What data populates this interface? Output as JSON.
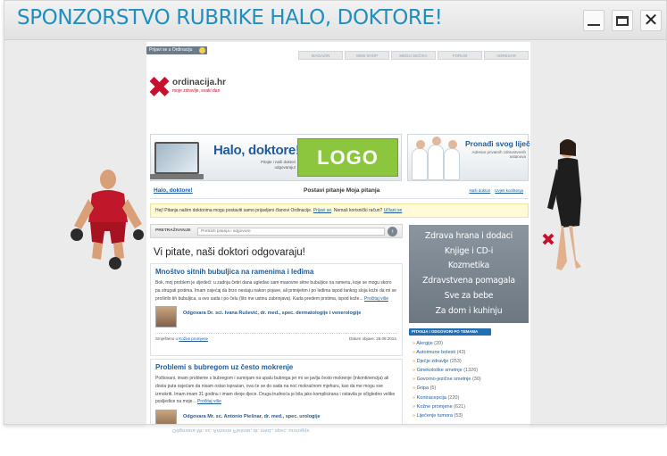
{
  "window": {
    "title": "SPONZORSTVO RUBRIKE HALO, DOKTORE!"
  },
  "site": {
    "login_label": "Prijavi se u Ordinaciju",
    "top_tabs": [
      "MAGAZIN",
      "WEB SHOP",
      "MEDIJ SEČIKA",
      "FORUM",
      "ADRESAR"
    ],
    "brand": {
      "name": "ordinacija.hr",
      "tagline": "moje zdravlje, svaki dan"
    },
    "banner_halo": {
      "title": "Halo, doktore!",
      "subtitle": "Pitajte i naši doktori odgovaraju!",
      "logo": "LOGO"
    },
    "banner_doc": {
      "title": "Pronađi svog liječnika!",
      "subtitle": "Adresar privatnih zdravstvenih ustanova"
    },
    "nav": {
      "home": "Halo, doktore!",
      "ask": "Postavi pitanje",
      "my": "Moja pitanja",
      "terms": "Naši doktori",
      "rules": "Uvjeti korištenja"
    },
    "notice": {
      "text": "Hej! Pitanja našim doktorima mogu postaviti samo prijavljeni članovi Ordinacije.",
      "login": "Prijavi se",
      "q": "Nemaš korisnički račun?",
      "register": "Učlani se"
    },
    "search": {
      "label": "PRETRAŽIVANJE",
      "placeholder": "Pretraži pitanja i odgovore"
    },
    "main_heading": "Vi pitate, naši doktori odgovaraju!",
    "questions": [
      {
        "title": "Mnoštvo sitnih bubuljica na ramenima i leđima",
        "text": "Bok, moj problem je sljedeći: u zadnja četiri dana ugledao sam masovne sitne bubuljice na ramenu, koje se mogu skoro pa strugati prstima. Imam osjećaj da brzo nestaju nakon pojave, ali primijetim i po leđima ispod tankog sloja kože da mi se proširilo tih bubuljica, a ovo sada i po čelu (što me ustinu zabrinjava). Kada predem prstima, ispod kože...",
        "more": "Pročitaj više",
        "answer": "Odgovara Dr. sci. Ivana Rušević, dr. med., spec. dermatologije i venerologije",
        "category_prefix": "Smješteno u",
        "category": "Kožne promjene",
        "date": "Datum objave: 26.09.2014."
      },
      {
        "title": "Problemi s bubregom uz često mokrenje",
        "text": "Poštovani, imam probleme s bubregom i sumnjam na upalu bubrega jer mi se javlja često mokrenje (inkontinencija) ali dosta puta osjećam da nisam ostao isprazan, ova će se do sada na noć mokraćnom mjehuru, kao da me mogu sve izmokriti. Imam imam 31 godinu i imam dvoje djece. Druga trudnoća je bila jako komplicirana i ostavila je očigledno velike posljedice na moje...",
        "more": "Pročitaj više",
        "answer": "Odgovara Mr. sc. Antonio Piešnar, dr. med., spec. urologije"
      }
    ],
    "categories": [
      "Zdrava hrana i dodaci",
      "Knjige i CD-i",
      "Kozmetika",
      "Zdravstvena pomagala",
      "Sve za bebe",
      "Za dom i kuhinju"
    ],
    "topics_heading": "PITANJA I ODGOVORI PO TEMAMA",
    "topics": [
      {
        "name": "Alergije",
        "count": "(20)"
      },
      {
        "name": "Autoimune bolesti",
        "count": "(43)"
      },
      {
        "name": "Dječje zdravlje",
        "count": "(253)"
      },
      {
        "name": "Ginekološke smetnje",
        "count": "(1326)"
      },
      {
        "name": "Govorno-jezične smetnje",
        "count": "(30)"
      },
      {
        "name": "Gripa",
        "count": "(5)"
      },
      {
        "name": "Kontracepcija",
        "count": "(220)"
      },
      {
        "name": "Kožne promjene",
        "count": "(621)"
      },
      {
        "name": "Liječenje tumora",
        "count": "(53)"
      }
    ]
  }
}
